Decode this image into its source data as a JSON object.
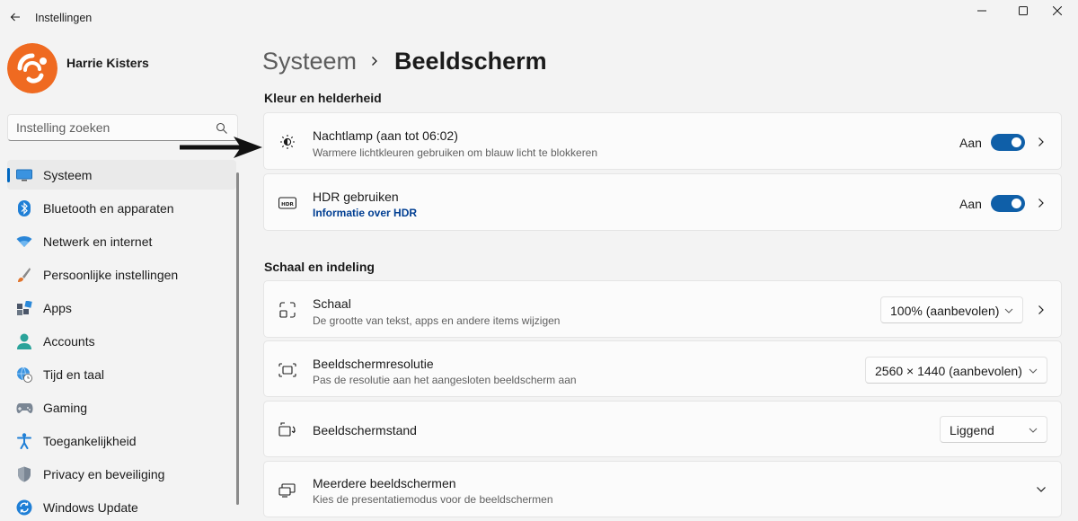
{
  "window": {
    "title": "Instellingen"
  },
  "profile": {
    "name": "Harrie Kisters"
  },
  "search": {
    "placeholder": "Instelling zoeken"
  },
  "sidebar": {
    "items": [
      {
        "label": "Systeem",
        "icon": "display-icon",
        "selected": true
      },
      {
        "label": "Bluetooth en apparaten",
        "icon": "bluetooth-icon"
      },
      {
        "label": "Netwerk en internet",
        "icon": "wifi-icon"
      },
      {
        "label": "Persoonlijke instellingen",
        "icon": "paintbrush-icon"
      },
      {
        "label": "Apps",
        "icon": "apps-icon"
      },
      {
        "label": "Accounts",
        "icon": "person-icon"
      },
      {
        "label": "Tijd en taal",
        "icon": "globe-clock-icon"
      },
      {
        "label": "Gaming",
        "icon": "gamepad-icon"
      },
      {
        "label": "Toegankelijkheid",
        "icon": "accessibility-icon"
      },
      {
        "label": "Privacy en beveiliging",
        "icon": "shield-icon"
      },
      {
        "label": "Windows Update",
        "icon": "update-icon"
      }
    ]
  },
  "breadcrumb": {
    "parent": "Systeem",
    "current": "Beeldscherm"
  },
  "sections": {
    "color": "Kleur en helderheid",
    "scale": "Schaal en indeling"
  },
  "night_light": {
    "title": "Nachtlamp (aan tot 06:02)",
    "subtitle": "Warmere lichtkleuren gebruiken om blauw licht te blokkeren",
    "state": "Aan",
    "on": true
  },
  "hdr": {
    "title": "HDR gebruiken",
    "link": "Informatie over HDR",
    "state": "Aan",
    "on": true
  },
  "scale": {
    "title": "Schaal",
    "subtitle": "De grootte van tekst, apps en andere items wijzigen",
    "value": "100% (aanbevolen)"
  },
  "resolution": {
    "title": "Beeldschermresolutie",
    "subtitle": "Pas de resolutie aan het aangesloten beeldscherm aan",
    "value": "2560 × 1440 (aanbevolen)"
  },
  "orientation": {
    "title": "Beeldschermstand",
    "value": "Liggend"
  },
  "multiple": {
    "title": "Meerdere beeldschermen",
    "subtitle": "Kies de presentatiemodus voor de beeldschermen"
  },
  "colors": {
    "accent": "#0067c0",
    "toggle_on": "#0f5fa8",
    "link": "#003e92"
  }
}
